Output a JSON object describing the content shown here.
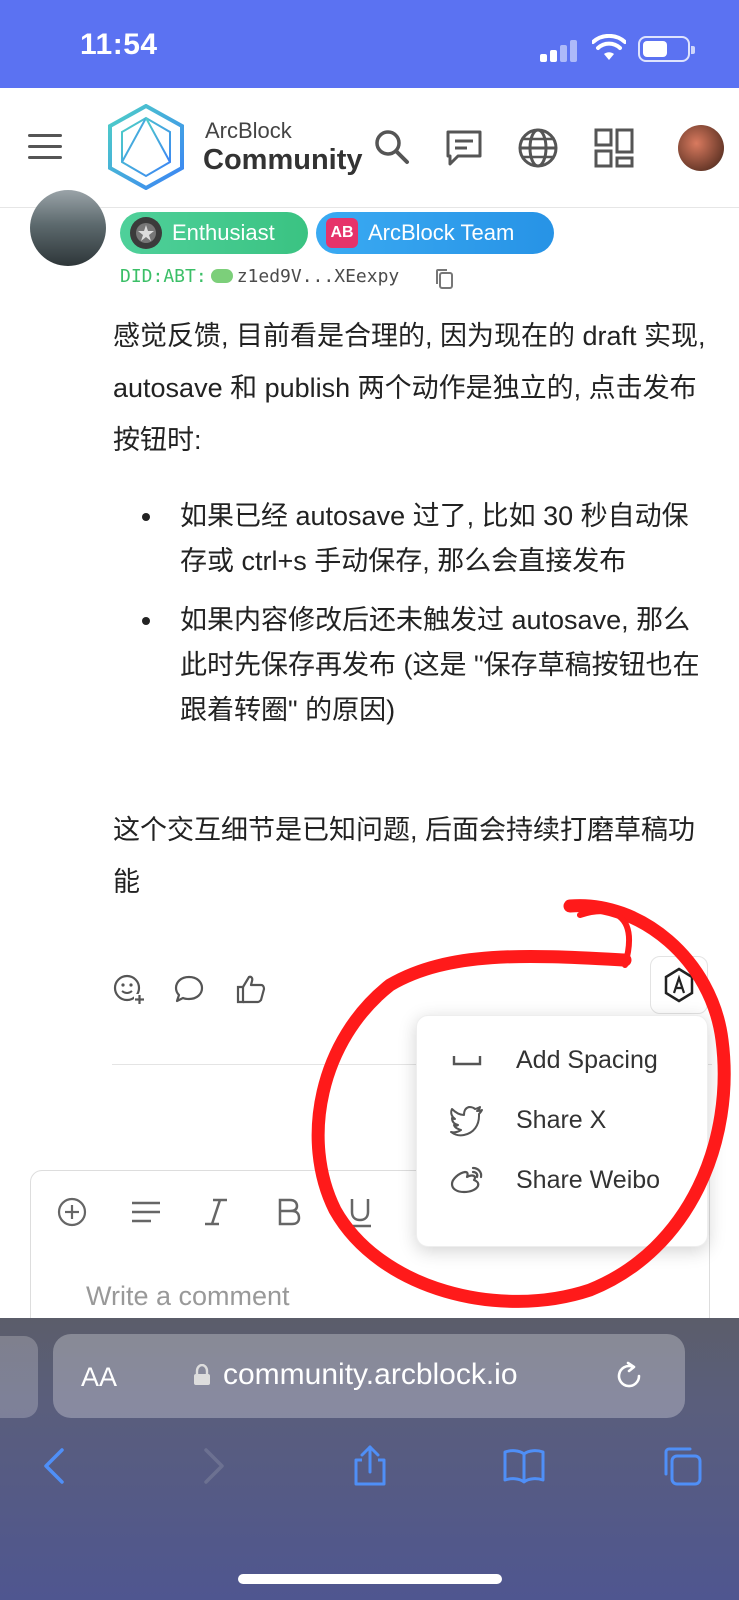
{
  "status_bar": {
    "time": "11:54"
  },
  "header": {
    "logo_line1": "ArcBlock",
    "logo_line2": "Community"
  },
  "post": {
    "badges": [
      {
        "label": "Enthusiast",
        "icon_text": ""
      },
      {
        "label": "ArcBlock Team",
        "icon_text": "AB"
      }
    ],
    "did_prefix": "DID:ABT:",
    "did_value": "z1ed9V...XEexpy",
    "paragraph1": "感觉反馈, 目前看是合理的, 因为现在的 draft 实现, autosave 和 publish 两个动作是独立的, 点击发布按钮时:",
    "bullets": [
      "如果已经 autosave 过了, 比如 30 秒自动保存或 ctrl+s 手动保存, 那么会直接发布",
      "如果内容修改后还未触发过 autosave, 那么此时先保存再发布 (这是 \"保存草稿按钮也在跟着转圈\" 的原因)"
    ],
    "paragraph2": "这个交互细节是已知问题, 后面会持续打磨草稿功能"
  },
  "menu": {
    "items": [
      {
        "label": "Add Spacing",
        "icon": "spacing-icon"
      },
      {
        "label": "Share X",
        "icon": "twitter-icon"
      },
      {
        "label": "Share Weibo",
        "icon": "weibo-icon"
      }
    ]
  },
  "editor": {
    "placeholder": "Write a comment"
  },
  "safari": {
    "aa_label": "AA",
    "url": "community.arcblock.io"
  },
  "colors": {
    "status_bar": "#5b72f2",
    "enthusiast_badge": "#3ac382",
    "team_badge": "#2793e6",
    "annotation_red": "#ff1a1a",
    "safari_accent": "#4f8ff7"
  }
}
